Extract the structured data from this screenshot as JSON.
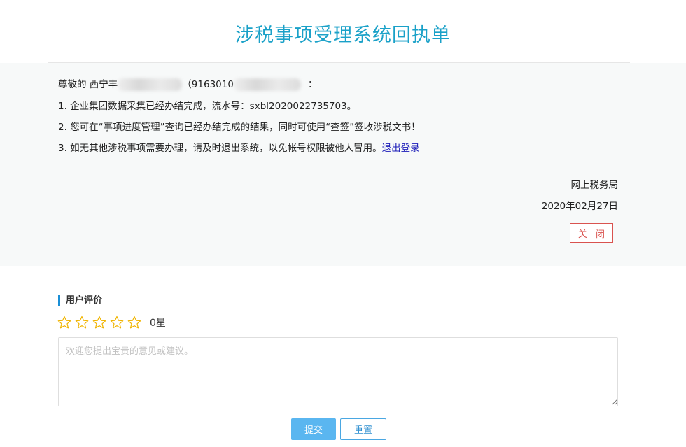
{
  "header": {
    "title": "涉税事项受理系统回执单"
  },
  "receipt": {
    "greeting_prefix": "尊敬的 西宁丰",
    "name_suffix": "（",
    "credit_code_prefix": "9163010",
    "greeting_end": "：",
    "line1": "1. 企业集团数据采集已经办结完成，流水号：sxbl2020022735703。",
    "line2": "2. 您可在“事项进度管理”查询已经办结完成的结果，同时可使用“查签”签收涉税文书！",
    "line3_text": "3. 如无其他涉税事项需要办理，请及时退出系统，以免帐号权限被他人冒用。",
    "logout_link": "退出登录",
    "issuer": "网上税务局",
    "date": "2020年02月27日",
    "close_label": "关 闭"
  },
  "evaluation": {
    "title": "用户评价",
    "rating": 0,
    "max_rating": 5,
    "score_text": "0星",
    "placeholder": "欢迎您提出宝贵的意见或建议。",
    "star_color": "#f0b400"
  },
  "actions": {
    "submit_label": "提交",
    "reset_label": "重置"
  }
}
